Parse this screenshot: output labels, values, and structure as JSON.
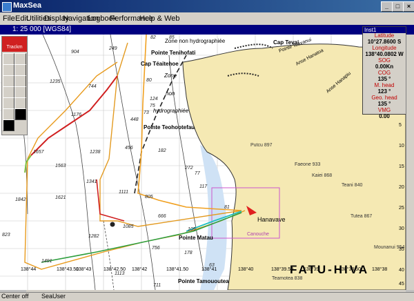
{
  "window": {
    "title": "MaxSea"
  },
  "menu": [
    {
      "label": "File"
    },
    {
      "label": "Edit"
    },
    {
      "label": "Utilities"
    },
    {
      "label": "Display"
    },
    {
      "label": "Navigation"
    },
    {
      "label": "Logbook"
    },
    {
      "label": "Performance"
    },
    {
      "label": "Help & Web"
    }
  ],
  "scale": {
    "text": "1: 25 000 [WGS84]"
  },
  "toolbox": {
    "label": "Trackm"
  },
  "info_panel": {
    "title": "Inst1",
    "rows": [
      {
        "label": "Latitude",
        "value": "10°27.8600 S"
      },
      {
        "label": "Longitude",
        "value": "138°40.0802 W"
      },
      {
        "label": "SOG",
        "value": "0.00Kn"
      },
      {
        "label": "COG",
        "value": "135 °"
      },
      {
        "label": "M. head",
        "value": "123 °"
      },
      {
        "label": "Geo. head",
        "value": "135 °"
      },
      {
        "label": "VMG",
        "value": "0.00"
      }
    ]
  },
  "chart": {
    "place_labels": [
      {
        "text": "Zone non hydrographiée"
      },
      {
        "text": "Cap Tevai"
      },
      {
        "text": "Pointe Teavanui"
      },
      {
        "text": "Pointe Tenihofati"
      },
      {
        "text": "Cap Téaitehoe"
      },
      {
        "text": "Anse Hanatoa"
      },
      {
        "text": "Anse Hanapiu"
      },
      {
        "text": "Zone"
      },
      {
        "text": "non"
      },
      {
        "text": "hydrographiée"
      },
      {
        "text": "Pointe Teohootefau"
      },
      {
        "text": "Hanavave"
      },
      {
        "text": "Pointe Matau"
      },
      {
        "text": "Pointe Tamououtea"
      },
      {
        "text": "Canouche"
      },
      {
        "text": "FATU-HIVA"
      }
    ],
    "soundings": [
      "904",
      "249",
      "1235",
      "744",
      "1176",
      "1657",
      "1563",
      "1238",
      "1341",
      "1842",
      "1621",
      "456",
      "448",
      "1111",
      "805",
      "272",
      "182",
      "77",
      "117",
      "666",
      "1085",
      "1282",
      "756",
      "178",
      "823",
      "1491",
      "1113",
      "711",
      "82",
      "85",
      "80",
      "73",
      "124",
      "75",
      "81",
      "105",
      "63"
    ],
    "land_peaks": [
      "Putcu 897",
      "Faeone 933",
      "Kaiei 868",
      "Teani 840",
      "Tutea 867",
      "Mounanui 954",
      "Teamotea 838"
    ],
    "lon_ticks": [
      "138°44",
      "138°43.50",
      "138°43",
      "138°42.50",
      "138°42",
      "138°41.50",
      "138°41",
      "138°40",
      "138°39.50",
      "138°39",
      "138°38.50",
      "138°38"
    ],
    "lat_ticks": [
      "5",
      "10",
      "15",
      "20",
      "25",
      "30",
      "35",
      "40",
      "45"
    ]
  },
  "status": {
    "left": "Center off",
    "mid": "SeaUser"
  }
}
